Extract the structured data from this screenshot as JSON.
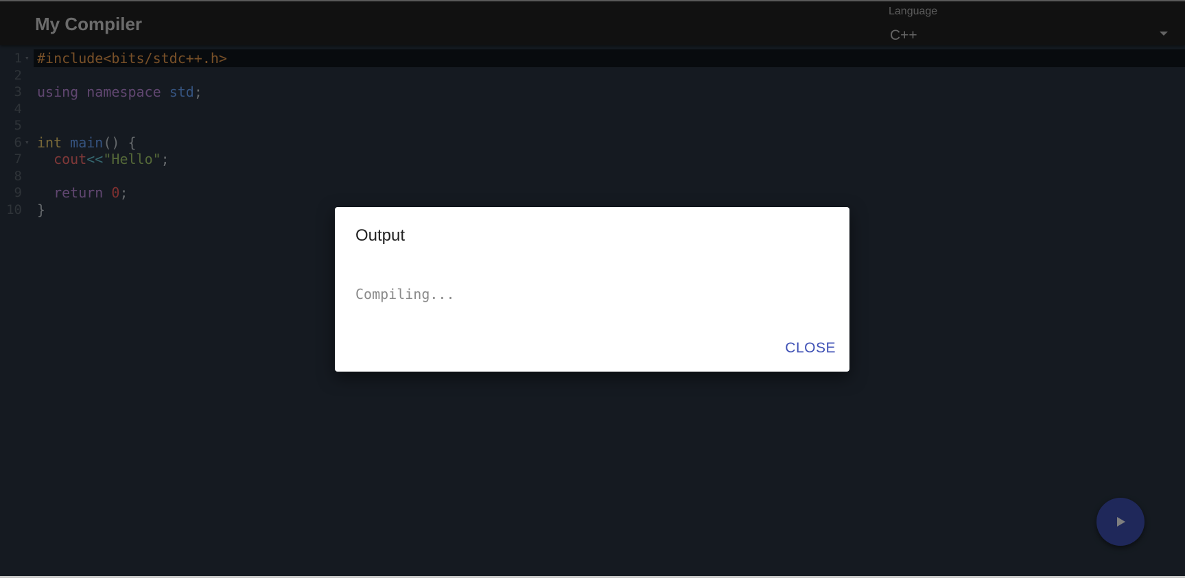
{
  "appbar": {
    "title": "My Compiler",
    "language_label": "Language",
    "language_value": "C++"
  },
  "editor": {
    "line_numbers": [
      "1",
      "2",
      "3",
      "4",
      "5",
      "6",
      "7",
      "8",
      "9",
      "10"
    ],
    "lines": [
      {
        "tokens": [
          {
            "text": "#include<bits/stdc++.h>",
            "cls": "t-pre"
          }
        ]
      },
      {
        "tokens": []
      },
      {
        "tokens": [
          {
            "text": "using",
            "cls": "t-kw"
          },
          {
            "text": " ",
            "cls": "t-punc"
          },
          {
            "text": "namespace",
            "cls": "t-ns"
          },
          {
            "text": " ",
            "cls": "t-punc"
          },
          {
            "text": "std",
            "cls": "t-std"
          },
          {
            "text": ";",
            "cls": "t-punc"
          }
        ]
      },
      {
        "tokens": []
      },
      {
        "tokens": []
      },
      {
        "tokens": [
          {
            "text": "int",
            "cls": "t-type"
          },
          {
            "text": " ",
            "cls": "t-punc"
          },
          {
            "text": "main",
            "cls": "t-fn"
          },
          {
            "text": "() {",
            "cls": "t-punc"
          }
        ]
      },
      {
        "tokens": [
          {
            "text": "  ",
            "cls": "t-punc"
          },
          {
            "text": "cout",
            "cls": "t-ident"
          },
          {
            "text": "<<",
            "cls": "t-op"
          },
          {
            "text": "\"Hello\"",
            "cls": "t-str"
          },
          {
            "text": ";",
            "cls": "t-punc"
          }
        ]
      },
      {
        "tokens": []
      },
      {
        "tokens": [
          {
            "text": "  ",
            "cls": "t-punc"
          },
          {
            "text": "return",
            "cls": "t-kw"
          },
          {
            "text": " ",
            "cls": "t-punc"
          },
          {
            "text": "0",
            "cls": "t-num"
          },
          {
            "text": ";",
            "cls": "t-punc"
          }
        ]
      },
      {
        "tokens": [
          {
            "text": "}",
            "cls": "t-punc"
          }
        ]
      }
    ],
    "fold_markers": {
      "0": "▾",
      "5": "▾"
    }
  },
  "dialog": {
    "title": "Output",
    "body": "Compiling...",
    "close_label": "CLOSE"
  },
  "fab": {
    "icon": "play-icon"
  },
  "colors": {
    "accent": "#3f51b5",
    "editor_bg": "#2a3542",
    "appbar_bg": "#232323"
  }
}
